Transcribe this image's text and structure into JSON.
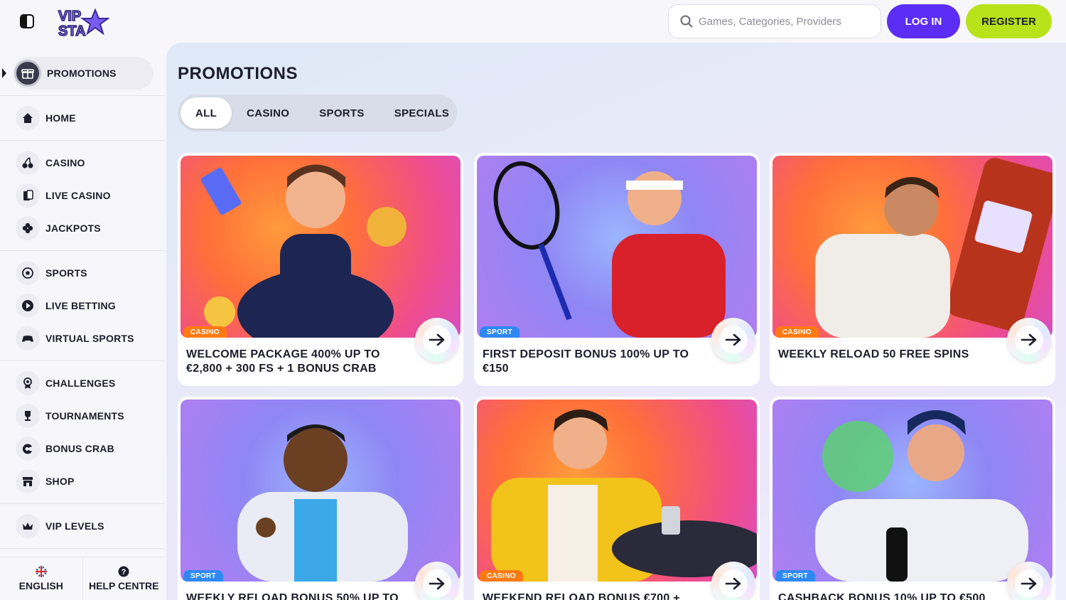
{
  "header": {
    "search_placeholder": "Games, Categories, Providers",
    "login_label": "LOG IN",
    "register_label": "REGISTER",
    "logo_text": "VIP STA"
  },
  "sidebar": {
    "active_item": {
      "label": "PROMOTIONS",
      "icon": "gift-icon"
    },
    "groups": [
      [
        {
          "label": "HOME",
          "icon": "home-icon"
        }
      ],
      [
        {
          "label": "CASINO",
          "icon": "cherries-icon"
        },
        {
          "label": "LIVE CASINO",
          "icon": "cards-icon"
        },
        {
          "label": "JACKPOTS",
          "icon": "clover-icon"
        }
      ],
      [
        {
          "label": "SPORTS",
          "icon": "soccer-ball-icon"
        },
        {
          "label": "LIVE BETTING",
          "icon": "play-icon"
        },
        {
          "label": "VIRTUAL SPORTS",
          "icon": "gamepad-icon"
        }
      ],
      [
        {
          "label": "CHALLENGES",
          "icon": "badge-icon"
        },
        {
          "label": "TOURNAMENTS",
          "icon": "trophy-icon"
        },
        {
          "label": "BONUS CRAB",
          "icon": "crab-icon"
        },
        {
          "label": "SHOP",
          "icon": "shop-icon"
        }
      ],
      [
        {
          "label": "VIP LEVELS",
          "icon": "crown-icon"
        }
      ]
    ],
    "language_label": "ENGLISH",
    "help_label": "HELP CENTRE"
  },
  "main": {
    "title": "PROMOTIONS",
    "tabs": [
      "ALL",
      "CASINO",
      "SPORTS",
      "SPECIALS"
    ],
    "active_tab": "ALL",
    "cards": [
      {
        "category": "CASINO",
        "title": "WELCOME PACKAGE 400% UP TO €2,800 + 300 FS + 1 BONUS CRAB",
        "theme": "warm"
      },
      {
        "category": "SPORT",
        "title": "FIRST DEPOSIT BONUS 100% UP TO €150",
        "theme": "cool"
      },
      {
        "category": "CASINO",
        "title": "WEEKLY RELOAD 50 FREE SPINS",
        "theme": "warm"
      },
      {
        "category": "SPORT",
        "title": "WEEKLY RELOAD BONUS 50% UP TO",
        "theme": "cool"
      },
      {
        "category": "CASINO",
        "title": "WEEKEND RELOAD BONUS €700 +",
        "theme": "warm"
      },
      {
        "category": "SPORT",
        "title": "CASHBACK BONUS 10% UP TO €500",
        "theme": "cool"
      }
    ]
  },
  "colors": {
    "login_bg": "#5c2df4",
    "register_bg": "#b8e21a",
    "casino_badge": "#ff7a12",
    "sport_badge": "#2f88f2"
  }
}
